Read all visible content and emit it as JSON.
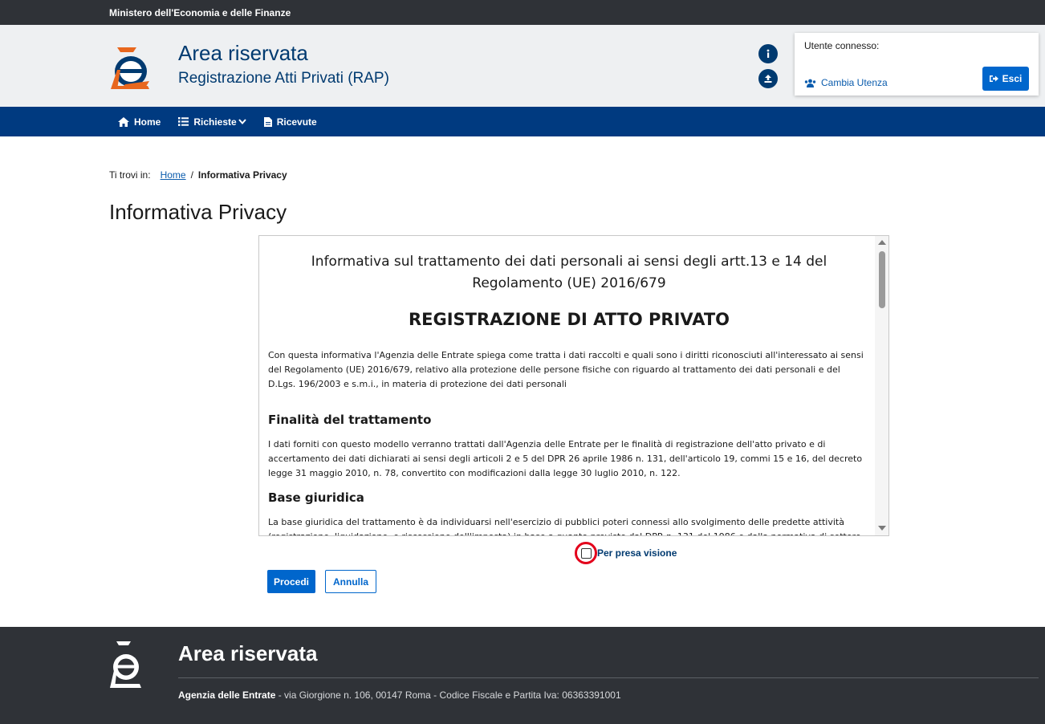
{
  "topbar": {
    "ministry": "Ministero dell'Economia e delle Finanze"
  },
  "header": {
    "title": "Area riservata",
    "subtitle": "Registrazione Atti Privati (RAP)",
    "user_label": "Utente connesso:",
    "cambia_utenza": "Cambia Utenza",
    "esci": "Esci"
  },
  "nav": {
    "items": [
      {
        "label": "Home",
        "icon": "home-icon"
      },
      {
        "label": "Richieste",
        "icon": "list-icon"
      },
      {
        "label": "Ricevute",
        "icon": "document-icon"
      }
    ]
  },
  "breadcrumb": {
    "prefix": "Ti trovi in:",
    "home": "Home",
    "separator": "/",
    "current": "Informativa Privacy"
  },
  "page_title": "Informativa Privacy",
  "privacy": {
    "heading": "Informativa sul trattamento dei dati personali ai sensi degli artt.13 e 14 del Regolamento (UE) 2016/679",
    "title": "REGISTRAZIONE DI ATTO PRIVATO",
    "intro": "Con questa informativa l'Agenzia delle Entrate spiega come tratta i dati raccolti e quali sono i diritti riconosciuti all'interessato ai sensi del Regolamento (UE) 2016/679, relativo alla protezione delle persone fisiche con riguardo al trattamento dei dati personali e del D.Lgs. 196/2003 e s.m.i., in materia di protezione dei dati personali",
    "section1_title": "Finalità del trattamento",
    "section1_text": "I dati forniti con questo modello verranno trattati dall'Agenzia delle Entrate per le finalità di registrazione dell'atto privato e di accertamento dei dati dichiarati ai sensi degli articoli 2 e 5 del DPR 26 aprile 1986 n. 131, dell'articolo 19, commi 15 e 16, del decreto legge 31 maggio 2010, n. 78, convertito con modificazioni dalla legge 30 luglio 2010, n. 122.",
    "section2_title": "Base giuridica",
    "section2_text": "La base giuridica del trattamento è da individuarsi nell'esercizio di pubblici poteri connessi allo svolgimento delle predette attività (registrazione, liquidazione, e riscossione dell'imposta) in base a quanto previsto dal DPR n. 131 del 1986 e dalla normativa di settore, di cui è"
  },
  "checkbox": {
    "label": "Per presa visione",
    "checked": false
  },
  "buttons": {
    "procedi": "Procedi",
    "annulla": "Annulla"
  },
  "footer": {
    "title": "Area riservata",
    "agency": "Agenzia delle Entrate",
    "address": " - via Giorgione n. 106, 00147 Roma - Codice Fiscale e Partita Iva: 06363391001"
  },
  "colors": {
    "primary": "#0066cc",
    "dark_blue": "#003a80",
    "dark_bar": "#2f3237",
    "highlight_ring": "#e3001b",
    "logo_orange": "#e8671e"
  }
}
